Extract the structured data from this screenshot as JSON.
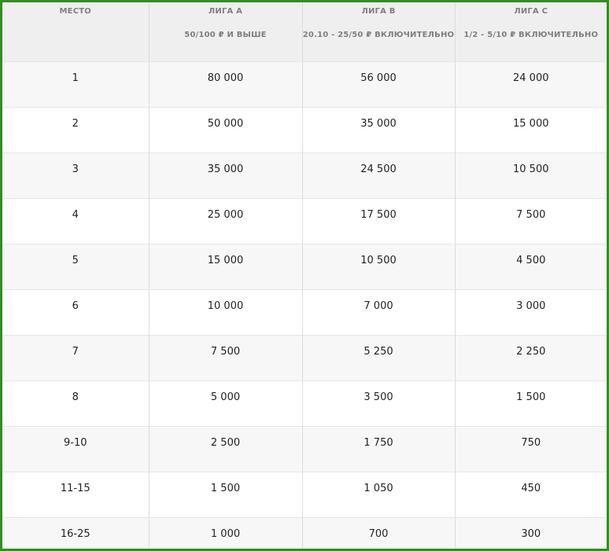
{
  "table": {
    "columns": [
      {
        "title": "МЕСТО",
        "subtitle": ""
      },
      {
        "title": "ЛИГА А",
        "subtitle": "50/100 ₽ И ВЫШЕ"
      },
      {
        "title": "ЛИГА В",
        "subtitle": "20.10 - 25/50 ₽ ВКЛЮЧИТЕЛЬНО"
      },
      {
        "title": "ЛИГА С",
        "subtitle": "1/2 - 5/10 ₽ ВКЛЮЧИТЕЛЬНО"
      }
    ],
    "rows": [
      [
        "1",
        "80 000",
        "56 000",
        "24 000"
      ],
      [
        "2",
        "50 000",
        "35 000",
        "15 000"
      ],
      [
        "3",
        "35 000",
        "24 500",
        "10 500"
      ],
      [
        "4",
        "25 000",
        "17 500",
        "7 500"
      ],
      [
        "5",
        "15 000",
        "10 500",
        "4 500"
      ],
      [
        "6",
        "10 000",
        "7 000",
        "3 000"
      ],
      [
        "7",
        "7 500",
        "5 250",
        "2 250"
      ],
      [
        "8",
        "5 000",
        "3 500",
        "1 500"
      ],
      [
        "9-10",
        "2 500",
        "1 750",
        "750"
      ],
      [
        "11-15",
        "1 500",
        "1 050",
        "450"
      ],
      [
        "16-25",
        "1 000",
        "700",
        "300"
      ]
    ]
  },
  "colors": {
    "border": "#2f8f1f",
    "header_bg": "#efefef",
    "header_text": "#7f7f7f"
  }
}
